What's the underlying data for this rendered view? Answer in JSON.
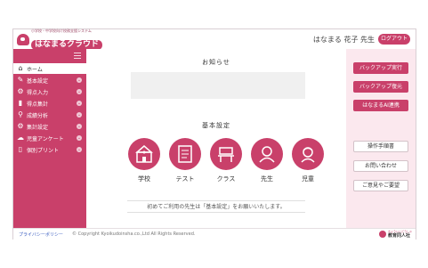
{
  "header": {
    "logo_tagline": "小学校・中学校向け校務支援システム",
    "logo_name": "はなまるクラウド",
    "user_name": "はなまる  花子  先生",
    "logout_label": "ログアウト"
  },
  "sidebar": {
    "items": [
      {
        "label": "ホーム",
        "icon": "home-icon",
        "active": true
      },
      {
        "label": "基本設定",
        "icon": "pencil-icon"
      },
      {
        "label": "得点入力",
        "icon": "gear-icon"
      },
      {
        "label": "得点集計",
        "icon": "bar-chart-icon"
      },
      {
        "label": "成績分析",
        "icon": "magnifier-icon"
      },
      {
        "label": "集計設定",
        "icon": "gear-icon"
      },
      {
        "label": "児童アンケート",
        "icon": "speech-bubble-icon"
      },
      {
        "label": "個別プリント",
        "icon": "document-icon"
      }
    ]
  },
  "main": {
    "notice_title": "お知らせ",
    "settings_title": "基本設定",
    "tiles": [
      {
        "label": "学校",
        "icon": "school-icon"
      },
      {
        "label": "テスト",
        "icon": "test-paper-icon"
      },
      {
        "label": "クラス",
        "icon": "desk-icon"
      },
      {
        "label": "先生",
        "icon": "teacher-icon"
      },
      {
        "label": "児童",
        "icon": "students-icon"
      }
    ],
    "welcome_text": "初めてご利用の先生は「基本設定」をお願いいたします。"
  },
  "right_panel": {
    "backup_run": "バックアップ実行",
    "backup_restore": "バックアップ復元",
    "ai_link": "はなまるAI連携",
    "manual": "操作手順書",
    "contact": "お問い合わせ",
    "feedback": "ご意見やご要望"
  },
  "footer": {
    "privacy": "プライバシーポリシー",
    "copyright": "© Copyright Kyoikudoinsha.co.,Ltd All Rights Reserved.",
    "logo_small": "きょういくどうしゃ",
    "logo_name": "教育同人社"
  },
  "colors": {
    "accent": "#c9406a",
    "panel": "#fbe8ee"
  }
}
